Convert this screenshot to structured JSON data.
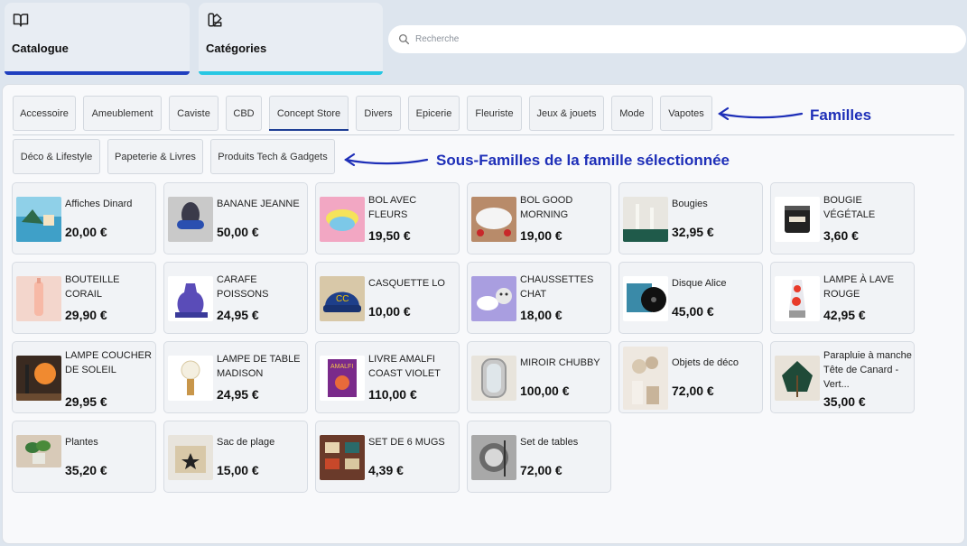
{
  "tabs": {
    "catalogue": {
      "label": "Catalogue",
      "icon": "book-icon",
      "accent": "#1f3fbf"
    },
    "categories": {
      "label": "Catégories",
      "icon": "categories-icon",
      "accent": "#27c7e3"
    }
  },
  "search": {
    "placeholder": "Recherche",
    "value": ""
  },
  "families": [
    "Accessoire",
    "Ameublement",
    "Caviste",
    "CBD",
    "Concept Store",
    "Divers",
    "Epicerie",
    "Fleuriste",
    "Jeux & jouets",
    "Mode",
    "Vapotes"
  ],
  "selected_family": "Concept Store",
  "subfamilies": [
    "Déco & Lifestyle",
    "Papeterie & Livres",
    "Produits Tech & Gadgets"
  ],
  "annotations": {
    "families": "Familles",
    "subfamilies": "Sous-Familles de la famille sélectionnée"
  },
  "products": [
    {
      "name": "Affiches Dinard",
      "price": "20,00 €"
    },
    {
      "name": "BANANE JEANNE",
      "price": "50,00 €"
    },
    {
      "name": "BOL AVEC FLEURS",
      "price": "19,50 €"
    },
    {
      "name": "BOL GOOD MORNING",
      "price": "19,00 €"
    },
    {
      "name": "Bougies",
      "price": "32,95 €"
    },
    {
      "name": "BOUGIE VÉGÉTALE",
      "price": "3,60 €"
    },
    {
      "name": "BOUTEILLE CORAIL",
      "price": "29,90 €"
    },
    {
      "name": "CARAFE POISSONS",
      "price": "24,95 €"
    },
    {
      "name": "CASQUETTE LO",
      "price": "10,00 €"
    },
    {
      "name": "CHAUSSETTES CHAT",
      "price": "18,00 €"
    },
    {
      "name": "Disque Alice",
      "price": "45,00 €"
    },
    {
      "name": "LAMPE À LAVE ROUGE",
      "price": "42,95 €"
    },
    {
      "name": "LAMPE COUCHER DE SOLEIL",
      "price": "29,95 €"
    },
    {
      "name": "LAMPE DE TABLE MADISON",
      "price": "24,95 €"
    },
    {
      "name": "LIVRE AMALFI COAST VIOLET",
      "price": "110,00 €"
    },
    {
      "name": "MIROIR CHUBBY",
      "price": "100,00 €"
    },
    {
      "name": "Objets de déco",
      "price": "72,00 €"
    },
    {
      "name": "Parapluie à manche Tête de Canard - Vert...",
      "price": "35,00 €"
    },
    {
      "name": "Plantes",
      "price": "35,20 €"
    },
    {
      "name": "Sac de plage",
      "price": "15,00 €"
    },
    {
      "name": "SET DE 6 MUGS",
      "price": "4,39 €"
    },
    {
      "name": "Set de tables",
      "price": "72,00 €"
    }
  ]
}
